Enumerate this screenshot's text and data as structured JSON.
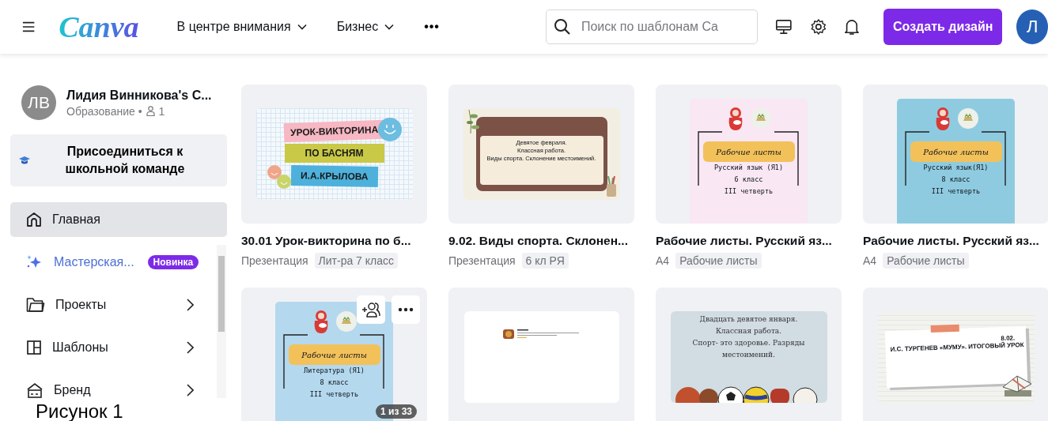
{
  "topbar": {
    "logo": "Canva",
    "nav": [
      {
        "label": "В центре внимания",
        "dropdown": true
      },
      {
        "label": "Бизнес",
        "dropdown": true
      }
    ],
    "more": "•••",
    "search": {
      "placeholder": "Поиск по шаблонам Ca"
    },
    "create_button": "Создать дизайн",
    "avatar": "Л"
  },
  "sidebar": {
    "team": {
      "initials": "ЛВ",
      "name": "Лидия Винникова's C...",
      "category": "Образование •",
      "members": "1"
    },
    "join_button": "Присоединиться к школьной команде",
    "items": [
      {
        "kind": "home",
        "label": "Главная",
        "selected": true,
        "has_submenu": false
      },
      {
        "kind": "magic",
        "label": "Мастерская...",
        "badge": "Новинка",
        "selected": false,
        "has_submenu": false
      },
      {
        "kind": "projects",
        "label": "Проекты",
        "selected": false,
        "has_submenu": true
      },
      {
        "kind": "templates",
        "label": "Шаблоны",
        "selected": false,
        "has_submenu": true
      },
      {
        "kind": "brand",
        "label": "Бренд",
        "selected": false,
        "has_submenu": true
      }
    ]
  },
  "caption": "Рисунок 1",
  "designs": [
    {
      "title": "30.01 Урок-викторина по б...",
      "format": "Презентация",
      "tag": "Лит-ра 7 класс",
      "hover": false,
      "thumb": {
        "kind": "quiz",
        "lines": [
          "УРОК-ВИКТОРИНА",
          "ПО БАСНЯМ",
          "И.А.КРЫЛОВА"
        ]
      }
    },
    {
      "title": "9.02. Виды спорта. Склонен...",
      "format": "Презентация",
      "tag": "6 кл РЯ",
      "hover": false,
      "thumb": {
        "kind": "board",
        "lines": [
          "Девятое февраля.",
          "Классная работа.",
          "Виды спорта. Склонение местоимений."
        ]
      }
    },
    {
      "title": "Рабочие листы. Русский яз...",
      "format": "A4",
      "tag": "Рабочие листы",
      "hover": false,
      "thumb": {
        "kind": "worksheet",
        "color": "#f9e7f4",
        "heading": "Рабочие листы",
        "lines": [
          "Русский язык (Я1)",
          "6 класс",
          "III четверть"
        ]
      }
    },
    {
      "title": "Рабочие листы. Русский яз...",
      "format": "A4",
      "tag": "Рабочие листы",
      "hover": false,
      "thumb": {
        "kind": "worksheet",
        "color": "#8fcbe0",
        "heading": "Рабочие листы",
        "lines": [
          "Русский язык(Я1)",
          "8 класс",
          "III четверть"
        ]
      }
    },
    {
      "hover": true,
      "page_badge": "1 из 33",
      "thumb": {
        "kind": "worksheet",
        "color": "#b4d8ee",
        "heading": "Рабочие листы",
        "lines": [
          "Литература (Я1)",
          "8 класс",
          "III четверть"
        ]
      }
    },
    {
      "hover": false,
      "thumb": {
        "kind": "blank"
      }
    },
    {
      "hover": false,
      "thumb": {
        "kind": "sport",
        "lines": [
          "Двадцать девятое января.",
          "Классная работа.",
          "Спорт- это здоровье. Разряды",
          "местоимений."
        ]
      }
    },
    {
      "hover": false,
      "thumb": {
        "kind": "note",
        "lines": [
          "8.02.",
          "И.С. ТУРГЕНЕВ «МУМУ». ИТОГОВЫЙ УРОК"
        ]
      }
    }
  ]
}
